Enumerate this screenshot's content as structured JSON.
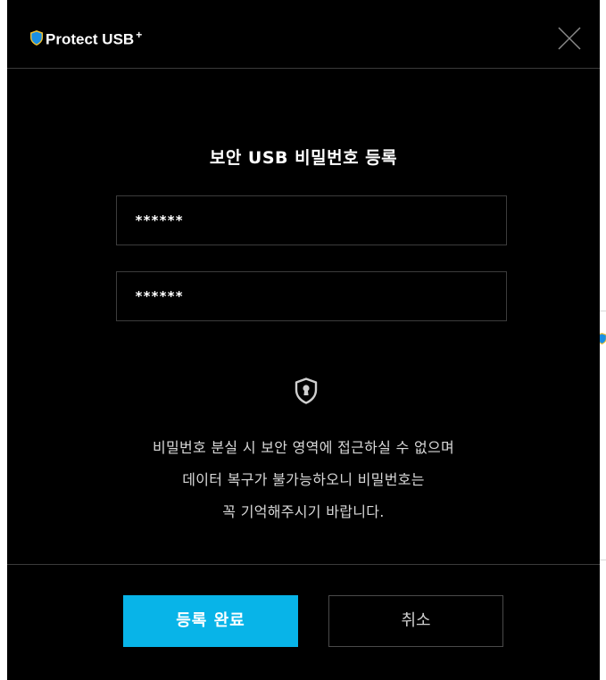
{
  "app": {
    "name": "Protect USB",
    "name_suffix": "+",
    "logo_icon": "shield-logo-icon",
    "accent_color": "#08b4e8"
  },
  "dialog": {
    "title": "보안 USB 비밀번호 등록",
    "password_value": "******",
    "confirm_password_value": "******",
    "notice_icon": "shield-keyhole-icon",
    "notice_lines": [
      "비밀번호 분실 시 보안 영역에 접근하실 수 없으며",
      "데이터 복구가 불가능하오니 비밀번호는",
      "꼭 기억해주시기 바랍니다."
    ],
    "confirm_button": "등록 완료",
    "cancel_button": "취소",
    "close_icon": "close-icon"
  }
}
